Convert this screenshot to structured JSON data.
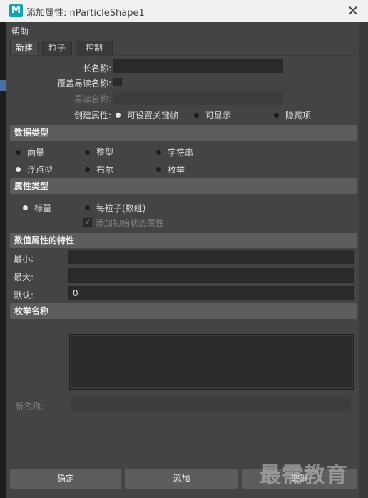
{
  "window": {
    "app_icon": "M",
    "title": "添加属性: nParticleShape1",
    "close_glyph": "✕"
  },
  "menu": {
    "help": "帮助"
  },
  "tabs": [
    "新建",
    "粒子",
    "控制"
  ],
  "form": {
    "long_name_label": "长名称:",
    "long_name_value": "",
    "override_nice_label": "覆盖易读名称:",
    "nice_name_label": "易读名称:",
    "nice_name_value": "",
    "make_attr_label": "创建属性:",
    "make_attr_options": [
      "可设置关键帧",
      "可显示",
      "隐藏项"
    ]
  },
  "data_type": {
    "header": "数据类型",
    "options": [
      "向量",
      "整型",
      "字符串",
      "浮点型",
      "布尔",
      "枚举"
    ],
    "selected": "浮点型"
  },
  "attr_type": {
    "header": "属性类型",
    "options": [
      "标量",
      "每粒子(数组)"
    ],
    "selected": "标量",
    "initial_state_label": "添加初始状态属性"
  },
  "numeric": {
    "header": "数值属性的特性",
    "min_label": "最小:",
    "min_value": "",
    "max_label": "最大:",
    "max_value": "",
    "default_label": "默认:",
    "default_value": "0"
  },
  "enum": {
    "header": "枚举名称",
    "new_name_label": "新名称:",
    "new_name_value": ""
  },
  "buttons": {
    "ok": "确定",
    "add": "添加",
    "cancel": "取消"
  },
  "watermark": "最需教育",
  "colors": {
    "panel": "#444444",
    "section": "#5d5d5d",
    "field": "#2b2b2b",
    "app_icon": "#16a3b0"
  }
}
